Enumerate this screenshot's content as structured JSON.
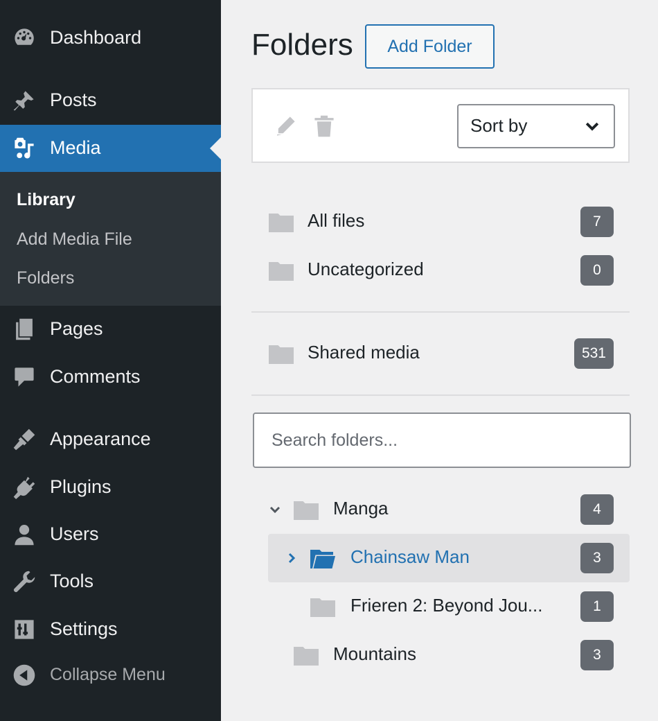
{
  "sidebar": {
    "items": [
      {
        "label": "Dashboard",
        "icon": "dashboard-icon"
      },
      {
        "label": "Posts",
        "icon": "pin-icon"
      },
      {
        "label": "Media",
        "icon": "media-icon"
      },
      {
        "label": "Pages",
        "icon": "pages-icon"
      },
      {
        "label": "Comments",
        "icon": "comment-icon"
      },
      {
        "label": "Appearance",
        "icon": "brush-icon"
      },
      {
        "label": "Plugins",
        "icon": "plug-icon"
      },
      {
        "label": "Users",
        "icon": "user-icon"
      },
      {
        "label": "Tools",
        "icon": "wrench-icon"
      },
      {
        "label": "Settings",
        "icon": "sliders-icon"
      }
    ],
    "submenu": [
      "Library",
      "Add Media File",
      "Folders"
    ],
    "collapse_label": "Collapse Menu",
    "active_color": "#2271b1"
  },
  "main": {
    "title": "Folders",
    "add_button": "Add Folder",
    "sort_label": "Sort by",
    "search_placeholder": "Search folders...",
    "special_folders": [
      {
        "label": "All files",
        "count": "7"
      },
      {
        "label": "Uncategorized",
        "count": "0"
      },
      {
        "label": "Shared media",
        "count": "531"
      }
    ],
    "tree": [
      {
        "label": "Manga",
        "count": "4",
        "expanded": true
      },
      {
        "label": "Chainsaw Man",
        "count": "3",
        "selected": true
      },
      {
        "label": "Frieren 2: Beyond Jou...",
        "count": "1"
      },
      {
        "label": "Mountains",
        "count": "3"
      }
    ],
    "accent_color": "#2271b1"
  }
}
